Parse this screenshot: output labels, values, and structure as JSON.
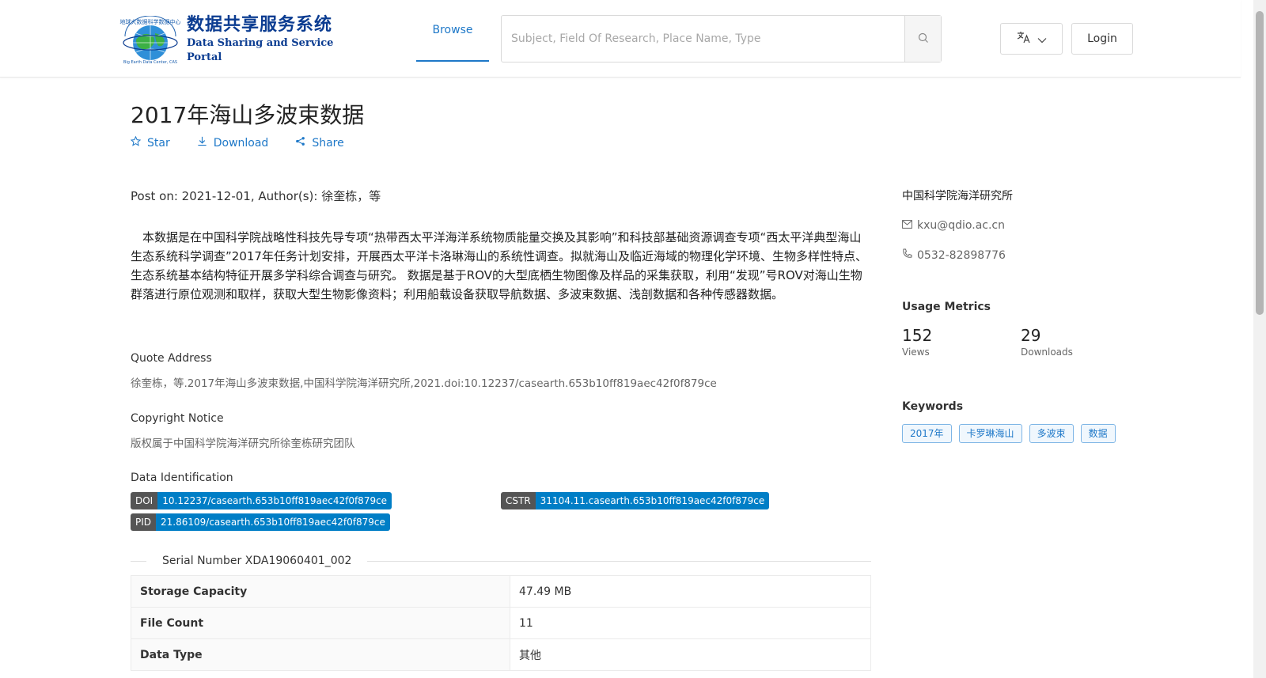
{
  "header": {
    "logo": {
      "tiny_cn": "地球大数据科学数据中心",
      "title_cn": "数据共享服务系统",
      "title_en": "Data Sharing and Service Portal",
      "globe_caption": "Big Earth Data Center, CAS"
    },
    "nav_browse": "Browse",
    "search_placeholder": "Subject, Field Of Research, Place Name, Type",
    "login": "Login",
    "colors": {
      "accent": "#1e78c8",
      "logo_blue": "#0b3c91"
    }
  },
  "page": {
    "title": "2017年海山多波束数据",
    "actions": {
      "star": "Star",
      "download": "Download",
      "share": "Share"
    },
    "post_line": "Post on: 2021-12-01, Author(s): 徐奎栋，等",
    "description": "本数据是在中国科学院战略性科技先导专项“热带西太平洋海洋系统物质能量交换及其影响”和科技部基础资源调查专项“西太平洋典型海山生态系统科学调查”2017年任务计划安排，开展西太平洋卡洛琳海山的系统性调查。拟就海山及临近海域的物理化学环境、生物多样性特点、生态系统基本结构特征开展多学科综合调查与研究。 数据是基于ROV的大型底栖生物图像及样品的采集获取，利用“发现”号ROV对海山生物群落进行原位观测和取样，获取大型生物影像资料；利用船载设备获取导航数据、多波束数据、浅剖数据和各种传感器数据。",
    "quote": {
      "label": "Quote Address",
      "value": "徐奎栋，等.2017年海山多波束数据,中国科学院海洋研究所,2021.doi:10.12237/casearth.653b10ff819aec42f0f879ce"
    },
    "copyright": {
      "label": "Copyright Notice",
      "value": "版权属于中国科学院海洋研究所徐奎栋研究团队"
    },
    "identification": {
      "label": "Data Identification",
      "doi_k": "DOI",
      "doi_v": "10.12237/casearth.653b10ff819aec42f0f879ce",
      "cstr_k": "CSTR",
      "cstr_v": "31104.11.casearth.653b10ff819aec42f0f879ce",
      "pid_k": "PID",
      "pid_v": "21.86109/casearth.653b10ff819aec42f0f879ce"
    },
    "serial": "Serial Number XDA19060401_002",
    "table": [
      {
        "k": "Storage Capacity",
        "v": "47.49 MB"
      },
      {
        "k": "File Count",
        "v": "11"
      },
      {
        "k": "Data Type",
        "v": "其他"
      }
    ]
  },
  "side": {
    "org": "中国科学院海洋研究所",
    "email": "kxu@qdio.ac.cn",
    "phone": "0532-82898776",
    "metrics_title": "Usage Metrics",
    "views_num": "152",
    "views_label": "Views",
    "downloads_num": "29",
    "downloads_label": "Downloads",
    "keywords_title": "Keywords",
    "keywords": [
      "2017年",
      "卡罗琳海山",
      "多波束",
      "数据"
    ]
  }
}
